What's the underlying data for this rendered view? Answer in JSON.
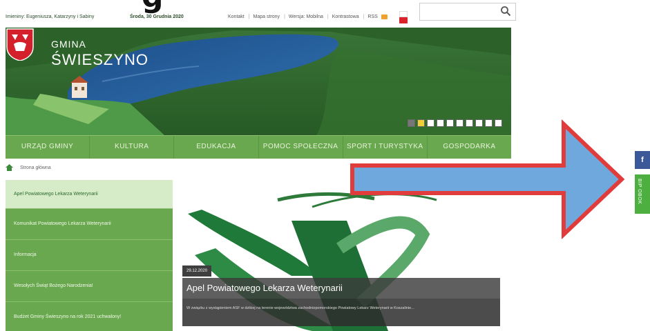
{
  "top_fragment": "g",
  "topbar": {
    "names": "Imieniny: Eugeniusza, Katarzyny i Sabiny",
    "date": "Środa, 30 Grudnia 2020",
    "links": [
      "Kontakt",
      "Mapa strony",
      "Wersja: Mobilna",
      "Kontrastowa",
      "RSS"
    ],
    "search_placeholder": ""
  },
  "hero": {
    "label": "GMINA",
    "name": "ŚWIESZYNO",
    "slides_total": 10,
    "slide_active": 2
  },
  "nav": {
    "items": [
      "URZĄD GMINY",
      "KULTURA",
      "EDUKACJA",
      "POMOC SPOŁECZNA",
      "SPORT I TURYSTYKA",
      "GOSPODARKA"
    ]
  },
  "breadcrumb": {
    "label": "Strona główna"
  },
  "sidebar": {
    "items": [
      "Apel Powiatowego Lekarza Weterynarii",
      "Komunikat Powiatowego Lekarza Weterynarii",
      "Informacja",
      "Wesołych Świąt Bożego Narodzenia!",
      "Budżet Gminy Świeszyno na rok 2021 uchwalony!"
    ]
  },
  "news": {
    "date": "29.12.2020",
    "title": "Apel Powiatowego Lekarza Weterynarii",
    "excerpt": "W związku z wystąpieniem ASF w dzikiej na terenie województwa zachodniopomorskiego Powiatowy Lekarz Weterynarii w Koszalinie..."
  },
  "social": {
    "facebook_label": "f",
    "bip_label": "BIP OBOK"
  },
  "colors": {
    "nav_green": "#6aa84f",
    "arrow_fill": "#6fa8dc",
    "arrow_border": "#e03c3c",
    "facebook": "#3b5998"
  }
}
